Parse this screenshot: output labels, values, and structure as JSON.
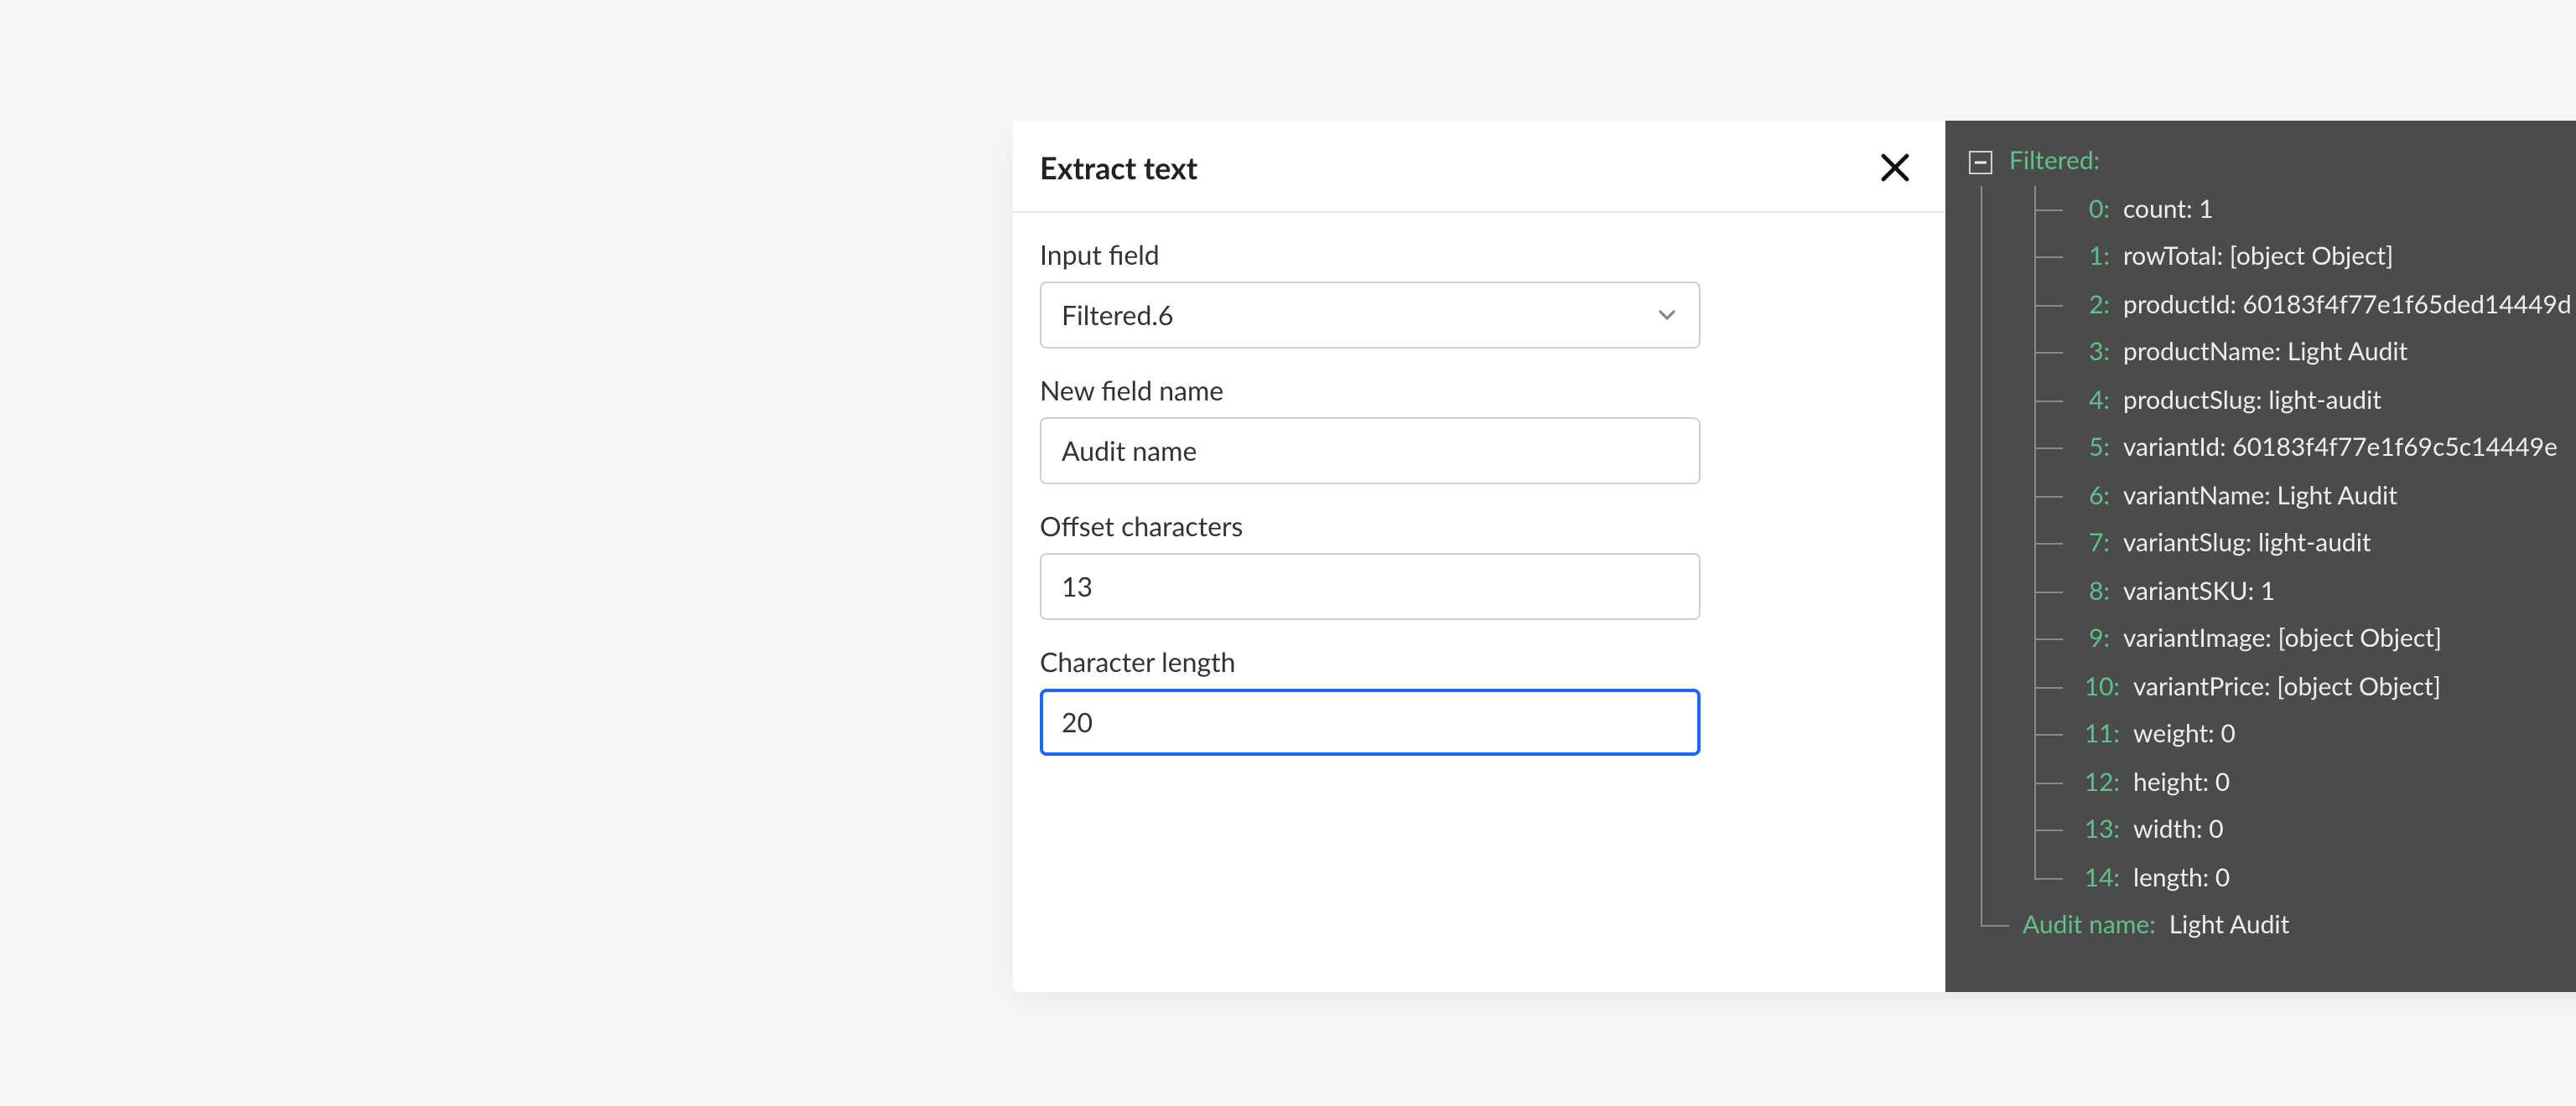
{
  "header": {
    "title": "Extract text"
  },
  "form": {
    "inputField": {
      "label": "Input field",
      "value": "Filtered.6"
    },
    "newFieldName": {
      "label": "New field name",
      "value": "Audit name"
    },
    "offset": {
      "label": "Offset characters",
      "value": "13"
    },
    "length": {
      "label": "Character length",
      "value": "20"
    }
  },
  "preview": {
    "rootLabel": "Filtered:",
    "items": [
      {
        "idx": "0:",
        "text": "count: 1"
      },
      {
        "idx": "1:",
        "text": "rowTotal: [object Object]"
      },
      {
        "idx": "2:",
        "text": "productId: 60183f4f77e1f65ded14449d"
      },
      {
        "idx": "3:",
        "text": "productName: Light Audit"
      },
      {
        "idx": "4:",
        "text": "productSlug: light-audit"
      },
      {
        "idx": "5:",
        "text": "variantId: 60183f4f77e1f69c5c14449e"
      },
      {
        "idx": "6:",
        "text": "variantName: Light Audit"
      },
      {
        "idx": "7:",
        "text": "variantSlug: light-audit"
      },
      {
        "idx": "8:",
        "text": "variantSKU: 1"
      },
      {
        "idx": "9:",
        "text": "variantImage: [object Object]"
      },
      {
        "idx": "10:",
        "text": "variantPrice: [object Object]"
      },
      {
        "idx": "11:",
        "text": "weight: 0"
      },
      {
        "idx": "12:",
        "text": "height: 0"
      },
      {
        "idx": "13:",
        "text": "width: 0"
      },
      {
        "idx": "14:",
        "text": "length: 0"
      }
    ],
    "result": {
      "key": "Audit name:",
      "value": "Light Audit"
    }
  }
}
